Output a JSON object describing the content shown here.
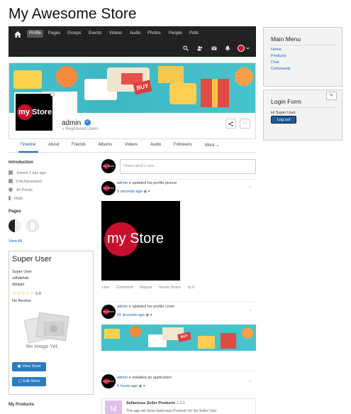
{
  "site": {
    "title": "My Awesome Store"
  },
  "nav": {
    "items": [
      "Profile",
      "Pages",
      "Groups",
      "Events",
      "Videos",
      "Audio",
      "Photos",
      "People",
      "Polls"
    ],
    "icons": [
      "search-icon",
      "users-icon",
      "mail-icon",
      "bell-icon",
      "avatar"
    ]
  },
  "profile": {
    "logo_text": "my Store",
    "name": "admin",
    "role": "Registered Users",
    "tabs": [
      "Timeline",
      "About",
      "Friends",
      "Albums",
      "Videos",
      "Audio",
      "Followers",
      "More"
    ],
    "active_tab": "Timeline"
  },
  "intro": {
    "title": "Introduction",
    "rows": [
      "Joined 1 day ago",
      "0 Achievement",
      "40 Points",
      "Male"
    ]
  },
  "pages": {
    "title": "Pages",
    "view_all": "View All"
  },
  "store_card": {
    "name": "Super User",
    "lines": [
      "Super User",
      "sdhdshds",
      "ddskjkl"
    ],
    "rating": "0.0",
    "rating_stars": 0,
    "review": "No Review",
    "no_image": "No Image Yet",
    "view_store": "View Store",
    "edit_store": "Edit Store"
  },
  "my_products": "My Products",
  "compose": {
    "placeholder": "Share what's new..."
  },
  "posts": [
    {
      "author": "admin",
      "action": "updated his profile picture",
      "time": "5 seconds ago",
      "image_text": "my Store"
    },
    {
      "author": "admin",
      "action": "updated his profile cover",
      "time": "31 seconds ago"
    },
    {
      "author": "admin",
      "action": "installed an application",
      "time": "5 hours ago",
      "app_title": "Sellacious Seller Products",
      "app_version": "1.0.0",
      "app_desc": "This app will show Sellacious Products for the Seller User",
      "app_letter": "M"
    }
  ],
  "post_actions": {
    "like": "Like",
    "comment": "Comment",
    "repost": "Repost",
    "share": "Social Share",
    "repost_count": "0"
  },
  "main_menu": {
    "title": "Main Menu",
    "links": [
      "Home",
      "Products",
      "Chat",
      "Community"
    ]
  },
  "login_form": {
    "title": "Login Form",
    "greeting": "Hi Super User,",
    "logout": "Log out"
  },
  "colors": {
    "accent": "#1a5fb4",
    "brand_red": "#c8102e",
    "navbar": "#222222",
    "banner": "#44c0c8"
  }
}
